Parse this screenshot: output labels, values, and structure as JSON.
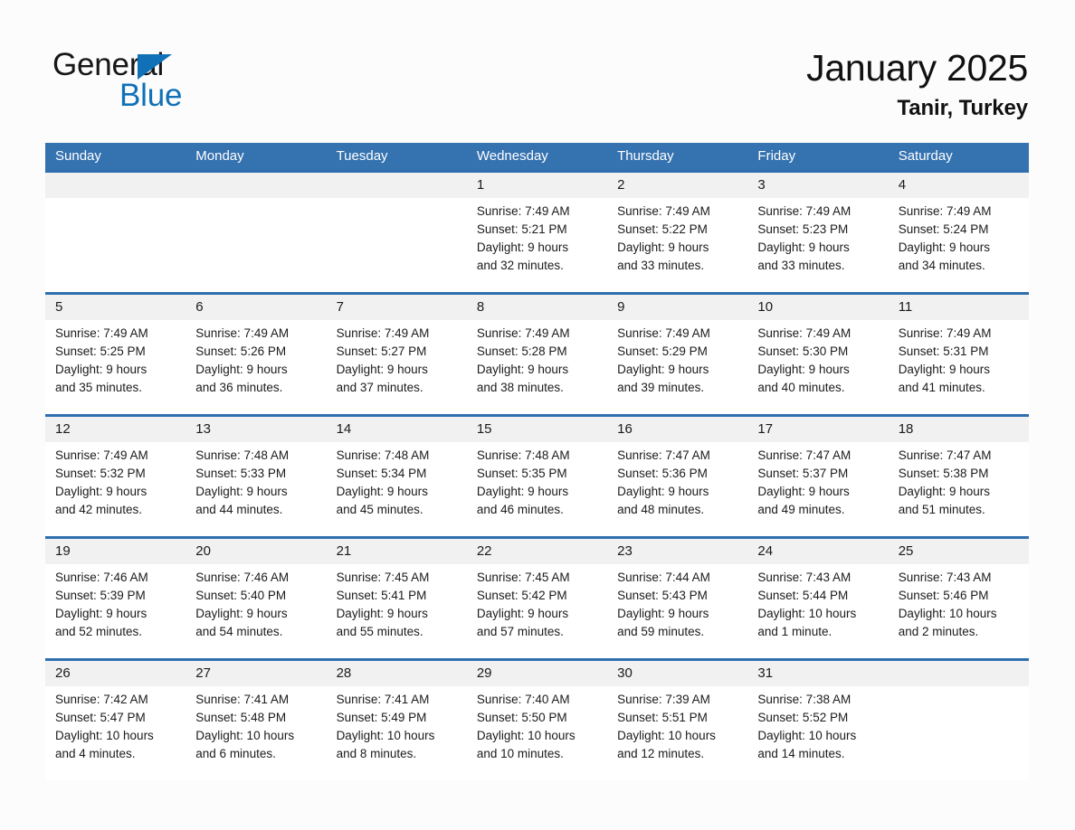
{
  "brand": {
    "name_top": "General",
    "name_bottom": "Blue",
    "accent_color": "#1071b8",
    "triangle_icon": "triangle-icon"
  },
  "header": {
    "month_title": "January 2025",
    "location": "Tanir, Turkey"
  },
  "theme": {
    "header_blue": "#3572b0",
    "row_divider_blue": "#2f6fae",
    "day_band_gray": "#f1f1f1",
    "page_background": "#fcfcfc",
    "text_color": "#1b1b1b"
  },
  "calendar": {
    "weekdays": [
      "Sunday",
      "Monday",
      "Tuesday",
      "Wednesday",
      "Thursday",
      "Friday",
      "Saturday"
    ],
    "weeks": [
      [
        {
          "day": "",
          "sunrise": "",
          "sunset": "",
          "daylight_1": "",
          "daylight_2": "",
          "empty": true
        },
        {
          "day": "",
          "sunrise": "",
          "sunset": "",
          "daylight_1": "",
          "daylight_2": "",
          "empty": true
        },
        {
          "day": "",
          "sunrise": "",
          "sunset": "",
          "daylight_1": "",
          "daylight_2": "",
          "empty": true
        },
        {
          "day": "1",
          "sunrise": "Sunrise: 7:49 AM",
          "sunset": "Sunset: 5:21 PM",
          "daylight_1": "Daylight: 9 hours",
          "daylight_2": "and 32 minutes."
        },
        {
          "day": "2",
          "sunrise": "Sunrise: 7:49 AM",
          "sunset": "Sunset: 5:22 PM",
          "daylight_1": "Daylight: 9 hours",
          "daylight_2": "and 33 minutes."
        },
        {
          "day": "3",
          "sunrise": "Sunrise: 7:49 AM",
          "sunset": "Sunset: 5:23 PM",
          "daylight_1": "Daylight: 9 hours",
          "daylight_2": "and 33 minutes."
        },
        {
          "day": "4",
          "sunrise": "Sunrise: 7:49 AM",
          "sunset": "Sunset: 5:24 PM",
          "daylight_1": "Daylight: 9 hours",
          "daylight_2": "and 34 minutes."
        }
      ],
      [
        {
          "day": "5",
          "sunrise": "Sunrise: 7:49 AM",
          "sunset": "Sunset: 5:25 PM",
          "daylight_1": "Daylight: 9 hours",
          "daylight_2": "and 35 minutes."
        },
        {
          "day": "6",
          "sunrise": "Sunrise: 7:49 AM",
          "sunset": "Sunset: 5:26 PM",
          "daylight_1": "Daylight: 9 hours",
          "daylight_2": "and 36 minutes."
        },
        {
          "day": "7",
          "sunrise": "Sunrise: 7:49 AM",
          "sunset": "Sunset: 5:27 PM",
          "daylight_1": "Daylight: 9 hours",
          "daylight_2": "and 37 minutes."
        },
        {
          "day": "8",
          "sunrise": "Sunrise: 7:49 AM",
          "sunset": "Sunset: 5:28 PM",
          "daylight_1": "Daylight: 9 hours",
          "daylight_2": "and 38 minutes."
        },
        {
          "day": "9",
          "sunrise": "Sunrise: 7:49 AM",
          "sunset": "Sunset: 5:29 PM",
          "daylight_1": "Daylight: 9 hours",
          "daylight_2": "and 39 minutes."
        },
        {
          "day": "10",
          "sunrise": "Sunrise: 7:49 AM",
          "sunset": "Sunset: 5:30 PM",
          "daylight_1": "Daylight: 9 hours",
          "daylight_2": "and 40 minutes."
        },
        {
          "day": "11",
          "sunrise": "Sunrise: 7:49 AM",
          "sunset": "Sunset: 5:31 PM",
          "daylight_1": "Daylight: 9 hours",
          "daylight_2": "and 41 minutes."
        }
      ],
      [
        {
          "day": "12",
          "sunrise": "Sunrise: 7:49 AM",
          "sunset": "Sunset: 5:32 PM",
          "daylight_1": "Daylight: 9 hours",
          "daylight_2": "and 42 minutes."
        },
        {
          "day": "13",
          "sunrise": "Sunrise: 7:48 AM",
          "sunset": "Sunset: 5:33 PM",
          "daylight_1": "Daylight: 9 hours",
          "daylight_2": "and 44 minutes."
        },
        {
          "day": "14",
          "sunrise": "Sunrise: 7:48 AM",
          "sunset": "Sunset: 5:34 PM",
          "daylight_1": "Daylight: 9 hours",
          "daylight_2": "and 45 minutes."
        },
        {
          "day": "15",
          "sunrise": "Sunrise: 7:48 AM",
          "sunset": "Sunset: 5:35 PM",
          "daylight_1": "Daylight: 9 hours",
          "daylight_2": "and 46 minutes."
        },
        {
          "day": "16",
          "sunrise": "Sunrise: 7:47 AM",
          "sunset": "Sunset: 5:36 PM",
          "daylight_1": "Daylight: 9 hours",
          "daylight_2": "and 48 minutes."
        },
        {
          "day": "17",
          "sunrise": "Sunrise: 7:47 AM",
          "sunset": "Sunset: 5:37 PM",
          "daylight_1": "Daylight: 9 hours",
          "daylight_2": "and 49 minutes."
        },
        {
          "day": "18",
          "sunrise": "Sunrise: 7:47 AM",
          "sunset": "Sunset: 5:38 PM",
          "daylight_1": "Daylight: 9 hours",
          "daylight_2": "and 51 minutes."
        }
      ],
      [
        {
          "day": "19",
          "sunrise": "Sunrise: 7:46 AM",
          "sunset": "Sunset: 5:39 PM",
          "daylight_1": "Daylight: 9 hours",
          "daylight_2": "and 52 minutes."
        },
        {
          "day": "20",
          "sunrise": "Sunrise: 7:46 AM",
          "sunset": "Sunset: 5:40 PM",
          "daylight_1": "Daylight: 9 hours",
          "daylight_2": "and 54 minutes."
        },
        {
          "day": "21",
          "sunrise": "Sunrise: 7:45 AM",
          "sunset": "Sunset: 5:41 PM",
          "daylight_1": "Daylight: 9 hours",
          "daylight_2": "and 55 minutes."
        },
        {
          "day": "22",
          "sunrise": "Sunrise: 7:45 AM",
          "sunset": "Sunset: 5:42 PM",
          "daylight_1": "Daylight: 9 hours",
          "daylight_2": "and 57 minutes."
        },
        {
          "day": "23",
          "sunrise": "Sunrise: 7:44 AM",
          "sunset": "Sunset: 5:43 PM",
          "daylight_1": "Daylight: 9 hours",
          "daylight_2": "and 59 minutes."
        },
        {
          "day": "24",
          "sunrise": "Sunrise: 7:43 AM",
          "sunset": "Sunset: 5:44 PM",
          "daylight_1": "Daylight: 10 hours",
          "daylight_2": "and 1 minute."
        },
        {
          "day": "25",
          "sunrise": "Sunrise: 7:43 AM",
          "sunset": "Sunset: 5:46 PM",
          "daylight_1": "Daylight: 10 hours",
          "daylight_2": "and 2 minutes."
        }
      ],
      [
        {
          "day": "26",
          "sunrise": "Sunrise: 7:42 AM",
          "sunset": "Sunset: 5:47 PM",
          "daylight_1": "Daylight: 10 hours",
          "daylight_2": "and 4 minutes."
        },
        {
          "day": "27",
          "sunrise": "Sunrise: 7:41 AM",
          "sunset": "Sunset: 5:48 PM",
          "daylight_1": "Daylight: 10 hours",
          "daylight_2": "and 6 minutes."
        },
        {
          "day": "28",
          "sunrise": "Sunrise: 7:41 AM",
          "sunset": "Sunset: 5:49 PM",
          "daylight_1": "Daylight: 10 hours",
          "daylight_2": "and 8 minutes."
        },
        {
          "day": "29",
          "sunrise": "Sunrise: 7:40 AM",
          "sunset": "Sunset: 5:50 PM",
          "daylight_1": "Daylight: 10 hours",
          "daylight_2": "and 10 minutes."
        },
        {
          "day": "30",
          "sunrise": "Sunrise: 7:39 AM",
          "sunset": "Sunset: 5:51 PM",
          "daylight_1": "Daylight: 10 hours",
          "daylight_2": "and 12 minutes."
        },
        {
          "day": "31",
          "sunrise": "Sunrise: 7:38 AM",
          "sunset": "Sunset: 5:52 PM",
          "daylight_1": "Daylight: 10 hours",
          "daylight_2": "and 14 minutes."
        },
        {
          "day": "",
          "sunrise": "",
          "sunset": "",
          "daylight_1": "",
          "daylight_2": "",
          "empty": true
        }
      ]
    ]
  }
}
